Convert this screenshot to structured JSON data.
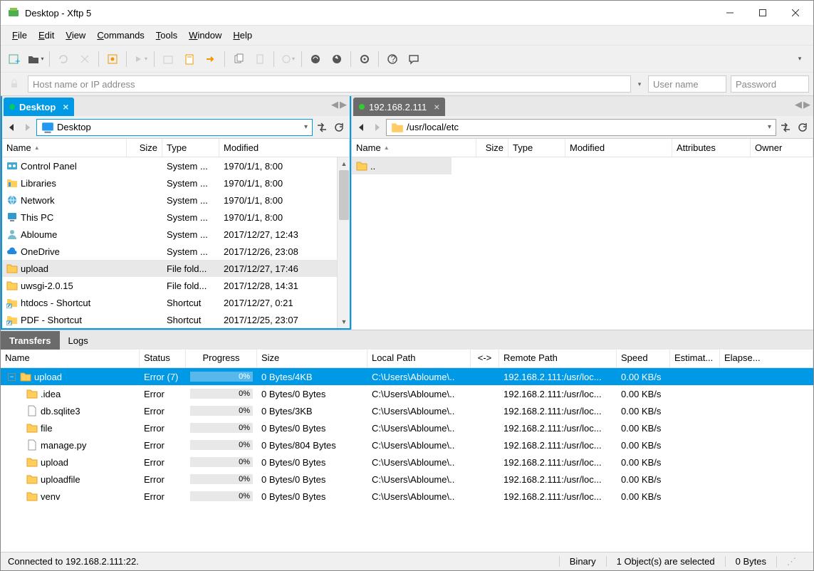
{
  "window": {
    "title": "Desktop - Xftp 5"
  },
  "menu": {
    "file": "File",
    "edit": "Edit",
    "view": "View",
    "commands": "Commands",
    "tools": "Tools",
    "window": "Window",
    "help": "Help"
  },
  "hostbar": {
    "host_placeholder": "Host name or IP address",
    "user_placeholder": "User name",
    "pass_placeholder": "Password"
  },
  "local": {
    "tab": "Desktop",
    "path": "Desktop",
    "cols": {
      "name": "Name",
      "size": "Size",
      "type": "Type",
      "modified": "Modified"
    },
    "rows": [
      {
        "name": "Control Panel",
        "size": "",
        "type": "System ...",
        "modified": "1970/1/1, 8:00",
        "icon": "cpl"
      },
      {
        "name": "Libraries",
        "size": "",
        "type": "System ...",
        "modified": "1970/1/1, 8:00",
        "icon": "lib"
      },
      {
        "name": "Network",
        "size": "",
        "type": "System ...",
        "modified": "1970/1/1, 8:00",
        "icon": "net"
      },
      {
        "name": "This PC",
        "size": "",
        "type": "System ...",
        "modified": "1970/1/1, 8:00",
        "icon": "pc"
      },
      {
        "name": "Abloume",
        "size": "",
        "type": "System ...",
        "modified": "2017/12/27, 12:43",
        "icon": "user"
      },
      {
        "name": "OneDrive",
        "size": "",
        "type": "System ...",
        "modified": "2017/12/26, 23:08",
        "icon": "cloud"
      },
      {
        "name": "upload",
        "size": "",
        "type": "File fold...",
        "modified": "2017/12/27, 17:46",
        "icon": "folder",
        "selected": true
      },
      {
        "name": "uwsgi-2.0.15",
        "size": "",
        "type": "File fold...",
        "modified": "2017/12/28, 14:31",
        "icon": "folder"
      },
      {
        "name": "htdocs - Shortcut",
        "size": "",
        "type": "Shortcut",
        "modified": "2017/12/27, 0:21",
        "icon": "shortcut"
      },
      {
        "name": "PDF - Shortcut",
        "size": "",
        "type": "Shortcut",
        "modified": "2017/12/25, 23:07",
        "icon": "shortcut"
      }
    ]
  },
  "remote": {
    "tab": "192.168.2.111",
    "path": "/usr/local/etc",
    "cols": {
      "name": "Name",
      "size": "Size",
      "type": "Type",
      "modified": "Modified",
      "attributes": "Attributes",
      "owner": "Owner"
    },
    "rows": [
      {
        "name": "..",
        "icon": "folder",
        "selected": true
      }
    ]
  },
  "bottomtabs": {
    "transfers": "Transfers",
    "logs": "Logs"
  },
  "xfer": {
    "cols": {
      "name": "Name",
      "status": "Status",
      "progress": "Progress",
      "size": "Size",
      "local": "Local Path",
      "dir": "<->",
      "remote": "Remote Path",
      "speed": "Speed",
      "estimate": "Estimat...",
      "elapsed": "Elapse..."
    },
    "rows": [
      {
        "name": "upload",
        "status": "Error (7)",
        "progress": "0%",
        "size": "0 Bytes/4KB",
        "local": "C:\\Users\\Abloume\\..",
        "remote": "192.168.2.111:/usr/loc...",
        "speed": "0.00 KB/s",
        "indent": 0,
        "icon": "folder",
        "sel": true,
        "exp": true
      },
      {
        "name": ".idea",
        "status": "Error",
        "progress": "0%",
        "size": "0 Bytes/0 Bytes",
        "local": "C:\\Users\\Abloume\\..",
        "remote": "192.168.2.111:/usr/loc...",
        "speed": "0.00 KB/s",
        "indent": 1,
        "icon": "folder"
      },
      {
        "name": "db.sqlite3",
        "status": "Error",
        "progress": "0%",
        "size": "0 Bytes/3KB",
        "local": "C:\\Users\\Abloume\\..",
        "remote": "192.168.2.111:/usr/loc...",
        "speed": "0.00 KB/s",
        "indent": 1,
        "icon": "file"
      },
      {
        "name": "file",
        "status": "Error",
        "progress": "0%",
        "size": "0 Bytes/0 Bytes",
        "local": "C:\\Users\\Abloume\\..",
        "remote": "192.168.2.111:/usr/loc...",
        "speed": "0.00 KB/s",
        "indent": 1,
        "icon": "folder"
      },
      {
        "name": "manage.py",
        "status": "Error",
        "progress": "0%",
        "size": "0 Bytes/804 Bytes",
        "local": "C:\\Users\\Abloume\\..",
        "remote": "192.168.2.111:/usr/loc...",
        "speed": "0.00 KB/s",
        "indent": 1,
        "icon": "file"
      },
      {
        "name": "upload",
        "status": "Error",
        "progress": "0%",
        "size": "0 Bytes/0 Bytes",
        "local": "C:\\Users\\Abloume\\..",
        "remote": "192.168.2.111:/usr/loc...",
        "speed": "0.00 KB/s",
        "indent": 1,
        "icon": "folder"
      },
      {
        "name": "uploadfile",
        "status": "Error",
        "progress": "0%",
        "size": "0 Bytes/0 Bytes",
        "local": "C:\\Users\\Abloume\\..",
        "remote": "192.168.2.111:/usr/loc...",
        "speed": "0.00 KB/s",
        "indent": 1,
        "icon": "folder"
      },
      {
        "name": "venv",
        "status": "Error",
        "progress": "0%",
        "size": "0 Bytes/0 Bytes",
        "local": "C:\\Users\\Abloume\\..",
        "remote": "192.168.2.111:/usr/loc...",
        "speed": "0.00 KB/s",
        "indent": 1,
        "icon": "folder"
      }
    ]
  },
  "status": {
    "conn": "Connected to 192.168.2.111:22.",
    "mode": "Binary",
    "sel": "1 Object(s) are selected",
    "bytes": "0 Bytes"
  }
}
